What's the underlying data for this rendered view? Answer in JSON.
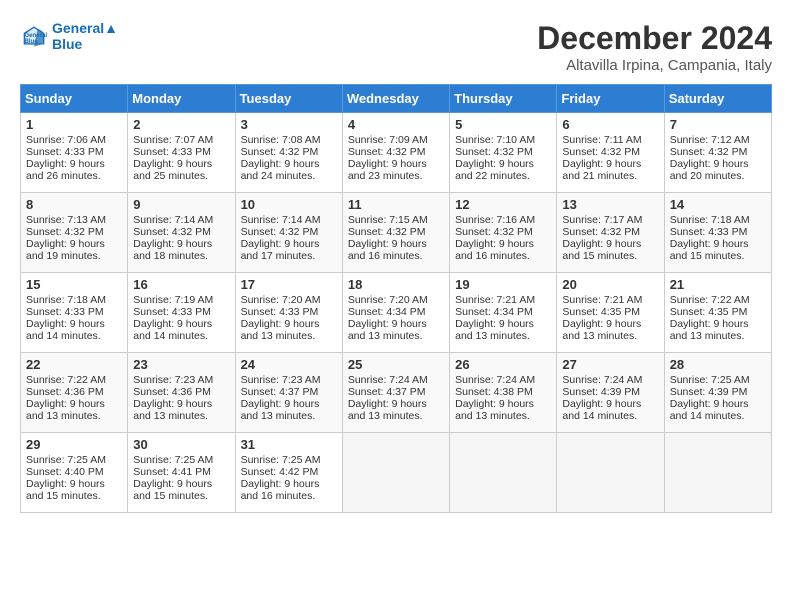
{
  "header": {
    "logo_line1": "General",
    "logo_line2": "Blue",
    "title": "December 2024",
    "location": "Altavilla Irpina, Campania, Italy"
  },
  "weekdays": [
    "Sunday",
    "Monday",
    "Tuesday",
    "Wednesday",
    "Thursday",
    "Friday",
    "Saturday"
  ],
  "weeks": [
    [
      {
        "day": 1,
        "sunrise": "7:06 AM",
        "sunset": "4:33 PM",
        "daylight": "9 hours and 26 minutes."
      },
      {
        "day": 2,
        "sunrise": "7:07 AM",
        "sunset": "4:33 PM",
        "daylight": "9 hours and 25 minutes."
      },
      {
        "day": 3,
        "sunrise": "7:08 AM",
        "sunset": "4:32 PM",
        "daylight": "9 hours and 24 minutes."
      },
      {
        "day": 4,
        "sunrise": "7:09 AM",
        "sunset": "4:32 PM",
        "daylight": "9 hours and 23 minutes."
      },
      {
        "day": 5,
        "sunrise": "7:10 AM",
        "sunset": "4:32 PM",
        "daylight": "9 hours and 22 minutes."
      },
      {
        "day": 6,
        "sunrise": "7:11 AM",
        "sunset": "4:32 PM",
        "daylight": "9 hours and 21 minutes."
      },
      {
        "day": 7,
        "sunrise": "7:12 AM",
        "sunset": "4:32 PM",
        "daylight": "9 hours and 20 minutes."
      }
    ],
    [
      {
        "day": 8,
        "sunrise": "7:13 AM",
        "sunset": "4:32 PM",
        "daylight": "9 hours and 19 minutes."
      },
      {
        "day": 9,
        "sunrise": "7:14 AM",
        "sunset": "4:32 PM",
        "daylight": "9 hours and 18 minutes."
      },
      {
        "day": 10,
        "sunrise": "7:14 AM",
        "sunset": "4:32 PM",
        "daylight": "9 hours and 17 minutes."
      },
      {
        "day": 11,
        "sunrise": "7:15 AM",
        "sunset": "4:32 PM",
        "daylight": "9 hours and 16 minutes."
      },
      {
        "day": 12,
        "sunrise": "7:16 AM",
        "sunset": "4:32 PM",
        "daylight": "9 hours and 16 minutes."
      },
      {
        "day": 13,
        "sunrise": "7:17 AM",
        "sunset": "4:32 PM",
        "daylight": "9 hours and 15 minutes."
      },
      {
        "day": 14,
        "sunrise": "7:18 AM",
        "sunset": "4:33 PM",
        "daylight": "9 hours and 15 minutes."
      }
    ],
    [
      {
        "day": 15,
        "sunrise": "7:18 AM",
        "sunset": "4:33 PM",
        "daylight": "9 hours and 14 minutes."
      },
      {
        "day": 16,
        "sunrise": "7:19 AM",
        "sunset": "4:33 PM",
        "daylight": "9 hours and 14 minutes."
      },
      {
        "day": 17,
        "sunrise": "7:20 AM",
        "sunset": "4:33 PM",
        "daylight": "9 hours and 13 minutes."
      },
      {
        "day": 18,
        "sunrise": "7:20 AM",
        "sunset": "4:34 PM",
        "daylight": "9 hours and 13 minutes."
      },
      {
        "day": 19,
        "sunrise": "7:21 AM",
        "sunset": "4:34 PM",
        "daylight": "9 hours and 13 minutes."
      },
      {
        "day": 20,
        "sunrise": "7:21 AM",
        "sunset": "4:35 PM",
        "daylight": "9 hours and 13 minutes."
      },
      {
        "day": 21,
        "sunrise": "7:22 AM",
        "sunset": "4:35 PM",
        "daylight": "9 hours and 13 minutes."
      }
    ],
    [
      {
        "day": 22,
        "sunrise": "7:22 AM",
        "sunset": "4:36 PM",
        "daylight": "9 hours and 13 minutes."
      },
      {
        "day": 23,
        "sunrise": "7:23 AM",
        "sunset": "4:36 PM",
        "daylight": "9 hours and 13 minutes."
      },
      {
        "day": 24,
        "sunrise": "7:23 AM",
        "sunset": "4:37 PM",
        "daylight": "9 hours and 13 minutes."
      },
      {
        "day": 25,
        "sunrise": "7:24 AM",
        "sunset": "4:37 PM",
        "daylight": "9 hours and 13 minutes."
      },
      {
        "day": 26,
        "sunrise": "7:24 AM",
        "sunset": "4:38 PM",
        "daylight": "9 hours and 13 minutes."
      },
      {
        "day": 27,
        "sunrise": "7:24 AM",
        "sunset": "4:39 PM",
        "daylight": "9 hours and 14 minutes."
      },
      {
        "day": 28,
        "sunrise": "7:25 AM",
        "sunset": "4:39 PM",
        "daylight": "9 hours and 14 minutes."
      }
    ],
    [
      {
        "day": 29,
        "sunrise": "7:25 AM",
        "sunset": "4:40 PM",
        "daylight": "9 hours and 15 minutes."
      },
      {
        "day": 30,
        "sunrise": "7:25 AM",
        "sunset": "4:41 PM",
        "daylight": "9 hours and 15 minutes."
      },
      {
        "day": 31,
        "sunrise": "7:25 AM",
        "sunset": "4:42 PM",
        "daylight": "9 hours and 16 minutes."
      },
      null,
      null,
      null,
      null
    ]
  ]
}
